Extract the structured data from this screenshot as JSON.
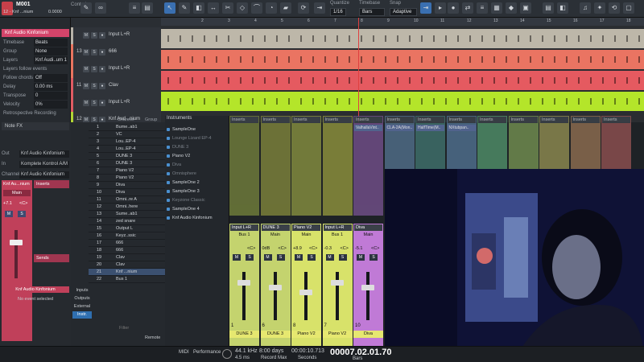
{
  "window": {
    "song": "M001",
    "track": "12 - Knf ...nium",
    "tempo_value": "0.0000",
    "control_label": "Control"
  },
  "toolbar": {
    "quantize_label": "Quantize",
    "quantize_value": "1/16",
    "timebase_label": "Timebase",
    "timebase_value": "Bars",
    "snap_label": "Snap",
    "snap_value": "Adaptive"
  },
  "inspector": {
    "instrument_name": "Knf Audio Kinfonium",
    "rows": [
      {
        "k": "Timebase",
        "v": "Beats"
      },
      {
        "k": "Group",
        "v": "None"
      },
      {
        "k": "Layers",
        "v": "Knf Audi..um 1"
      },
      {
        "k": "Layers follow events",
        "v": ""
      },
      {
        "k": "Follow chords",
        "v": "Off"
      },
      {
        "k": "Delay",
        "v": "0.00 ms"
      },
      {
        "k": "Transpose",
        "v": "0"
      },
      {
        "k": "Velocity",
        "v": "0%"
      },
      {
        "k": "Retrospective Recording",
        "v": ""
      }
    ]
  },
  "tracks": [
    {
      "num": "",
      "name": "Input L+R",
      "color": "#b7b2a8"
    },
    {
      "num": "13",
      "name": "666",
      "color": "#e9745f"
    },
    {
      "num": "",
      "name": "Input L+R",
      "color": "#e9745f"
    },
    {
      "num": "11",
      "name": "Clav",
      "color": "#e05b63"
    },
    {
      "num": "",
      "name": "Input L+R",
      "color": "#e05b63"
    },
    {
      "num": "12",
      "name": "Knf Aud...nium",
      "color": "#b2d634"
    }
  ],
  "arrange_lanes": [
    {
      "color": "#bdb7a9"
    },
    {
      "color": "#ea7462"
    },
    {
      "color": "#e55a60"
    },
    {
      "color": "#b4e52a"
    }
  ],
  "ruler_marks": [
    "2",
    "3",
    "4",
    "5",
    "6",
    "7",
    "8",
    "9",
    "10",
    "11",
    "12",
    "13",
    "14",
    "15",
    "16",
    "17",
    "18"
  ],
  "channel_list": {
    "header_channel": "Channel",
    "header_group": "Group",
    "items": [
      {
        "n": "1",
        "name": "Bume..ab1"
      },
      {
        "n": "2",
        "name": "VC"
      },
      {
        "n": "3",
        "name": "Lou..EP-4"
      },
      {
        "n": "4",
        "name": "Lou..EP-4"
      },
      {
        "n": "5",
        "name": "DUNE 3"
      },
      {
        "n": "6",
        "name": "DUNE 3"
      },
      {
        "n": "7",
        "name": "Piano V2"
      },
      {
        "n": "8",
        "name": "Piano V2"
      },
      {
        "n": "9",
        "name": "Diva"
      },
      {
        "n": "10",
        "name": "Diva"
      },
      {
        "n": "11",
        "name": "Omni..re A"
      },
      {
        "n": "12",
        "name": "Omni..here"
      },
      {
        "n": "13",
        "name": "Sume..ab1"
      },
      {
        "n": "14",
        "name": "zed snare"
      },
      {
        "n": "15",
        "name": "Output L"
      },
      {
        "n": "16",
        "name": "Keyz..ssic"
      },
      {
        "n": "17",
        "name": "666"
      },
      {
        "n": "18",
        "name": "666"
      },
      {
        "n": "19",
        "name": "Clav"
      },
      {
        "n": "20",
        "name": "Clav"
      },
      {
        "n": "21",
        "name": "Knf ...nium"
      },
      {
        "n": "22",
        "name": "Bus 1"
      }
    ],
    "side_tabs": [
      "Inputs",
      "Outputs",
      "External",
      "Instr."
    ],
    "filter_placeholder": "Filter",
    "remote_label": "Remote"
  },
  "instruments": {
    "header": "Instruments",
    "items": [
      "SampleOne",
      "Lounge Lizard EP-4",
      "DUNE 3",
      "Piano V2",
      "Diva",
      "Omnisphere",
      "SampleOne 2",
      "SampleOne 3",
      "Keyzone Classic",
      "SampleOne 4",
      "Knf Audio Kinfonium"
    ]
  },
  "left_mix": {
    "note_fx_label": "Note FX",
    "out_label": "Out",
    "out_value": "Knf Audio Kinfonium",
    "in_label": "In",
    "in_value": "Komplete Kontrol A/M",
    "channel_label": "Channel",
    "channel_value": "Knf Audio Kinfonium",
    "strip_name": "Knf Au...nium",
    "strip_bus": "Main",
    "inserts_label": "Inserts",
    "sends_label": "Sends",
    "value_left": "+7.1",
    "value_right": "<C>",
    "channel_number": "21",
    "bottom_name": "Knf Audio Kinfonium",
    "no_event": "No event selected"
  },
  "strips": [
    {
      "input": "Input L+R",
      "bus": "Bus 1",
      "val": "",
      "pan": "<C>",
      "num": "1",
      "name": "DUNE 3",
      "color": "#c4d36e"
    },
    {
      "input": "DUNE 3",
      "bus": "Main",
      "val": "0dB",
      "pan": "<C>",
      "num": "6",
      "name": "DUNE 3",
      "color": "#c4d36e"
    },
    {
      "input": "Piano V2",
      "bus": "Main",
      "val": "+8.9",
      "pan": "<C>",
      "num": "8",
      "name": "Piano V2",
      "color": "#d8e26a"
    },
    {
      "input": "Input L+R",
      "bus": "Bus 1",
      "val": "-0.3",
      "pan": "<C>",
      "num": "7",
      "name": "Piano V2",
      "color": "#d8e26a"
    },
    {
      "input": "Diva",
      "bus": "Main",
      "val": "-5.1",
      "pan": "<C>",
      "num": "10",
      "name": "Diva",
      "color": "#c07ad6"
    },
    {
      "input": "Input L+R",
      "bus": "Bus 1",
      "val": "-6.4",
      "pan": "",
      "num": "9",
      "name": "Diva",
      "color": "#c07ad6"
    }
  ],
  "top_inserts": [
    {
      "label": "Inserts",
      "plugin": ""
    },
    {
      "label": "Inserts",
      "plugin": ""
    },
    {
      "label": "Inserts",
      "plugin": ""
    },
    {
      "label": "Inserts",
      "plugin": ""
    },
    {
      "label": "Inserts",
      "plugin": "ValhallaVint.."
    },
    {
      "label": "Inserts",
      "plugin": "CLA-2A(Mon.."
    },
    {
      "label": "Inserts",
      "plugin": "HalfTime(M.."
    },
    {
      "label": "Inserts",
      "plugin": "NXtubpan.."
    },
    {
      "label": "Inserts",
      "plugin": ""
    },
    {
      "label": "Inserts",
      "plugin": ""
    },
    {
      "label": "Inserts",
      "plugin": ""
    },
    {
      "label": "Inserts",
      "plugin": ""
    },
    {
      "label": "Inserts",
      "plugin": ""
    }
  ],
  "top_colors": [
    "#6d7a3a",
    "#7a7f3a",
    "#818a3e",
    "#8a8d3c",
    "#6f4d86",
    "#4f6b86",
    "#3e6e6a",
    "#4e6d8a",
    "#4e8a66",
    "#6e8a4e",
    "#8a864e",
    "#8a6a4e",
    "#8a4e4e"
  ],
  "status": {
    "midi": "MIDI",
    "performance": "Performance",
    "sample_rate": "44.1 kHz",
    "latency": "4.5 ms",
    "record_days": "8:00 days",
    "record_label": "Record Max",
    "seconds": "00:00:10.713",
    "seconds_label": "Seconds",
    "bars": "00007.02.01.70",
    "bars_label": "Bars"
  }
}
